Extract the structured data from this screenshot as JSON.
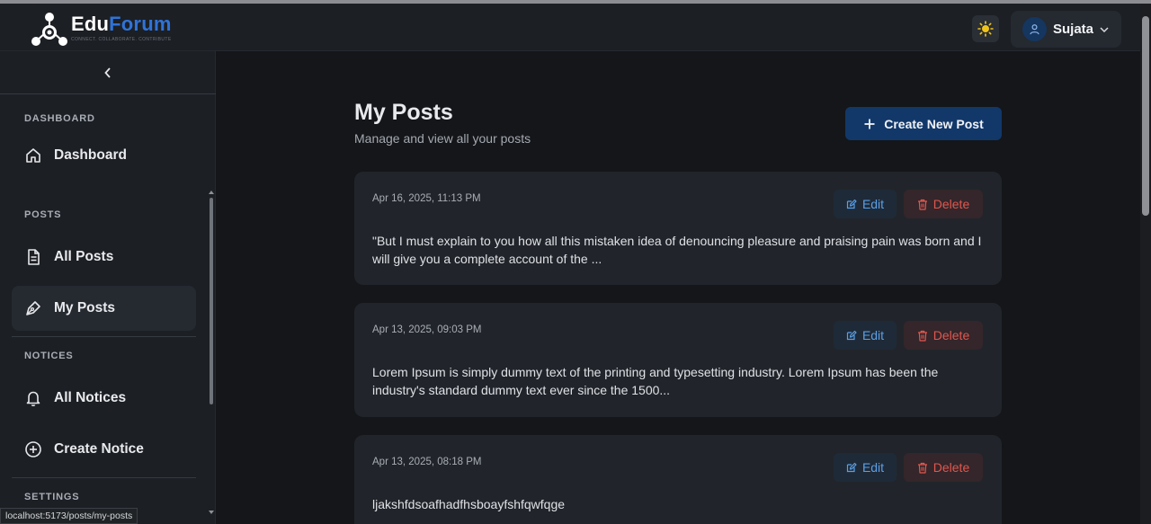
{
  "app": {
    "logo_edu": "Edu",
    "logo_forum": "Forum",
    "logo_tagline": "CONNECT. COLLABORATE. CONTRIBUTE",
    "colors": {
      "accent": "#2f73d8",
      "primary_button": "#12386a",
      "danger": "#e0574f",
      "edit": "#5aa0e6"
    }
  },
  "header": {
    "theme_icon": "sun-icon",
    "user_name": "Sujata"
  },
  "sidebar": {
    "collapse_icon": "chevron-left-icon",
    "sections": [
      {
        "label": "DASHBOARD",
        "items": [
          {
            "label": "Dashboard",
            "icon": "home-icon"
          }
        ]
      },
      {
        "label": "POSTS",
        "items": [
          {
            "label": "All Posts",
            "icon": "document-icon"
          },
          {
            "label": "My Posts",
            "icon": "pen-icon",
            "active": true
          }
        ]
      },
      {
        "label": "NOTICES",
        "items": [
          {
            "label": "All Notices",
            "icon": "bell-icon"
          },
          {
            "label": "Create Notice",
            "icon": "plus-circle-icon"
          }
        ]
      },
      {
        "label": "SETTINGS",
        "items": []
      }
    ]
  },
  "main": {
    "title": "My Posts",
    "subtitle": "Manage and view all your posts",
    "create_button": "Create New Post",
    "edit_label": "Edit",
    "delete_label": "Delete",
    "posts": [
      {
        "date": "Apr 16, 2025, 11:13 PM",
        "excerpt": "\"But I must explain to you how all this mistaken idea of denouncing pleasure and praising pain was born and I will give you a complete account of the ..."
      },
      {
        "date": "Apr 13, 2025, 09:03 PM",
        "excerpt": "Lorem Ipsum is simply dummy text of the printing and typesetting industry. Lorem Ipsum has been the industry's standard dummy text ever since the 1500..."
      },
      {
        "date": "Apr 13, 2025, 08:18 PM",
        "excerpt": "ljakshfdsoafhadfhsboayfshfqwfqge"
      }
    ]
  },
  "status_bar": {
    "url": "localhost:5173/posts/my-posts"
  }
}
